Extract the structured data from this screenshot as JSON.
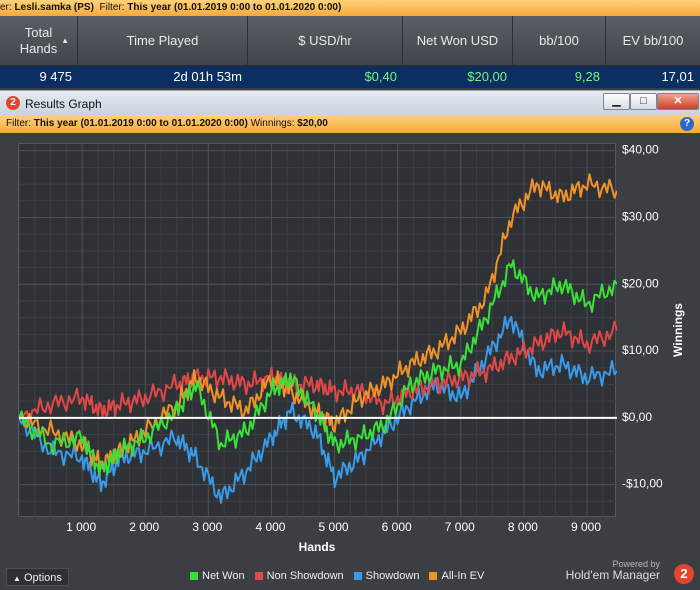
{
  "topbar": {
    "player_label": "er:",
    "player": "Lesli.samka (PS)",
    "filter_label": "Filter:",
    "filter_value": "This year",
    "filter_range": "(01.01.2019 0:00 to 01.01.2020 0:00)"
  },
  "stats": {
    "headers": [
      "Total Hands",
      "Time Played",
      "$ USD/hr",
      "Net Won USD",
      "bb/100",
      "EV bb/100"
    ],
    "row": [
      "9 475",
      "2d 01h 53m",
      "$0,40",
      "$20,00",
      "9,28",
      "17,01"
    ],
    "colors": {
      "positive": "#7cf07c",
      "neutral": "#ffffff"
    }
  },
  "window": {
    "title": "Results Graph",
    "icon_number": "2",
    "min_icon": "minimize-icon",
    "max_icon": "maximize-icon",
    "close_icon": "close-icon"
  },
  "filterbar": {
    "filter_label": "Filter:",
    "filter_value": "This year (01.01.2019 0:00 to 01.01.2020 0:00)",
    "winnings_label": "Winnings:",
    "winnings_value": "$20,00"
  },
  "footer": {
    "options_label": "Options",
    "powered_by": "Powered by",
    "brand": "Hold'em Manager",
    "brand_number": "2"
  },
  "chart_data": {
    "type": "line",
    "xlabel": "Hands",
    "ylabel": "Winnings",
    "xlim": [
      0,
      9475
    ],
    "ylim": [
      -15,
      41
    ],
    "x_ticks": [
      1000,
      2000,
      3000,
      4000,
      5000,
      6000,
      7000,
      8000,
      9000
    ],
    "x_tick_labels": [
      "1 000",
      "2 000",
      "3 000",
      "4 000",
      "5 000",
      "6 000",
      "7 000",
      "8 000",
      "9 000"
    ],
    "y_ticks": [
      -10,
      0,
      10,
      20,
      30,
      40
    ],
    "y_tick_labels": [
      "-$10,00",
      "$0,00",
      "$10,00",
      "$20,00",
      "$30,00",
      "$40,00"
    ],
    "grid": true,
    "legend_position": "bottom",
    "x": [
      0,
      500,
      1000,
      1300,
      1600,
      2000,
      2500,
      2800,
      3200,
      3600,
      4000,
      4300,
      4700,
      5000,
      5400,
      5800,
      6200,
      6600,
      7000,
      7400,
      7800,
      8200,
      8600,
      9000,
      9475
    ],
    "series": [
      {
        "name": "Net Won",
        "color": "#38e038",
        "values": [
          0,
          -4,
          -3,
          -8,
          -5,
          -3,
          1,
          5,
          -4,
          -2,
          4,
          6,
          1,
          -4,
          -3,
          -1,
          5,
          7,
          8,
          15,
          23,
          18,
          20,
          17,
          20
        ]
      },
      {
        "name": "Non Showdown",
        "color": "#e04848",
        "values": [
          0,
          2,
          3,
          1,
          2,
          3,
          5,
          6,
          6,
          5,
          6,
          5,
          5,
          4,
          4,
          2,
          4,
          5,
          6,
          7,
          9,
          11,
          13,
          11,
          13
        ]
      },
      {
        "name": "Showdown",
        "color": "#3a9ae6",
        "values": [
          0,
          -5,
          -6,
          -10,
          -6,
          -5,
          -3,
          -6,
          -12,
          -8,
          -3,
          1,
          -2,
          -9,
          -6,
          -2,
          2,
          5,
          3,
          9,
          15,
          7,
          8,
          6,
          7
        ]
      },
      {
        "name": "All-In EV",
        "color": "#f0922a",
        "values": [
          0,
          -2,
          -4,
          -7,
          -5,
          -2,
          2,
          6,
          3,
          1,
          6,
          4,
          1,
          -1,
          3,
          5,
          8,
          10,
          13,
          18,
          30,
          35,
          33,
          35,
          34
        ]
      }
    ]
  }
}
